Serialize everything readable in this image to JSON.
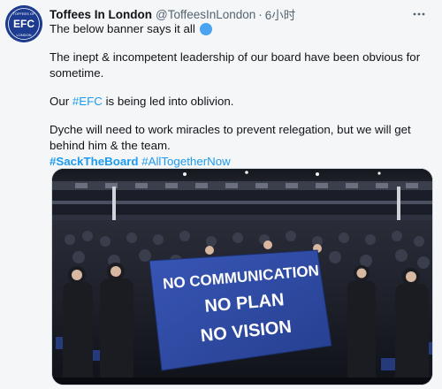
{
  "account": {
    "display_name": "Toffees In London",
    "handle": "@ToffeesInLondon",
    "separator": "·",
    "time": "6小时",
    "avatar_text": {
      "top": "TOFFEES OF",
      "center": "EFC",
      "bottom": "LONDON"
    }
  },
  "tweet": {
    "line1": "The below banner says it all",
    "line2": "The inept & incompetent leadership of our board have been obvious for sometime.",
    "line3_prefix": "Our ",
    "line3_tag": "#EFC",
    "line3_suffix": " is being led into oblivion.",
    "line4": "Dyche will need to work miracles to prevent relegation, but we will get behind him & the team.",
    "hashtags": [
      "#SackTheBoard",
      "#AllTogetherNow"
    ]
  },
  "media": {
    "banner_lines": [
      "NO COMMUNICATION",
      "NO PLAN",
      "NO VISION"
    ]
  },
  "colors": {
    "link": "#1d9bf0",
    "avatar_bg": "#1d3c8f",
    "banner_blue": "#2f4fa8"
  },
  "icons": {
    "more": "more-horizontal-icon",
    "badge": "blue-circle-emoji-icon"
  }
}
